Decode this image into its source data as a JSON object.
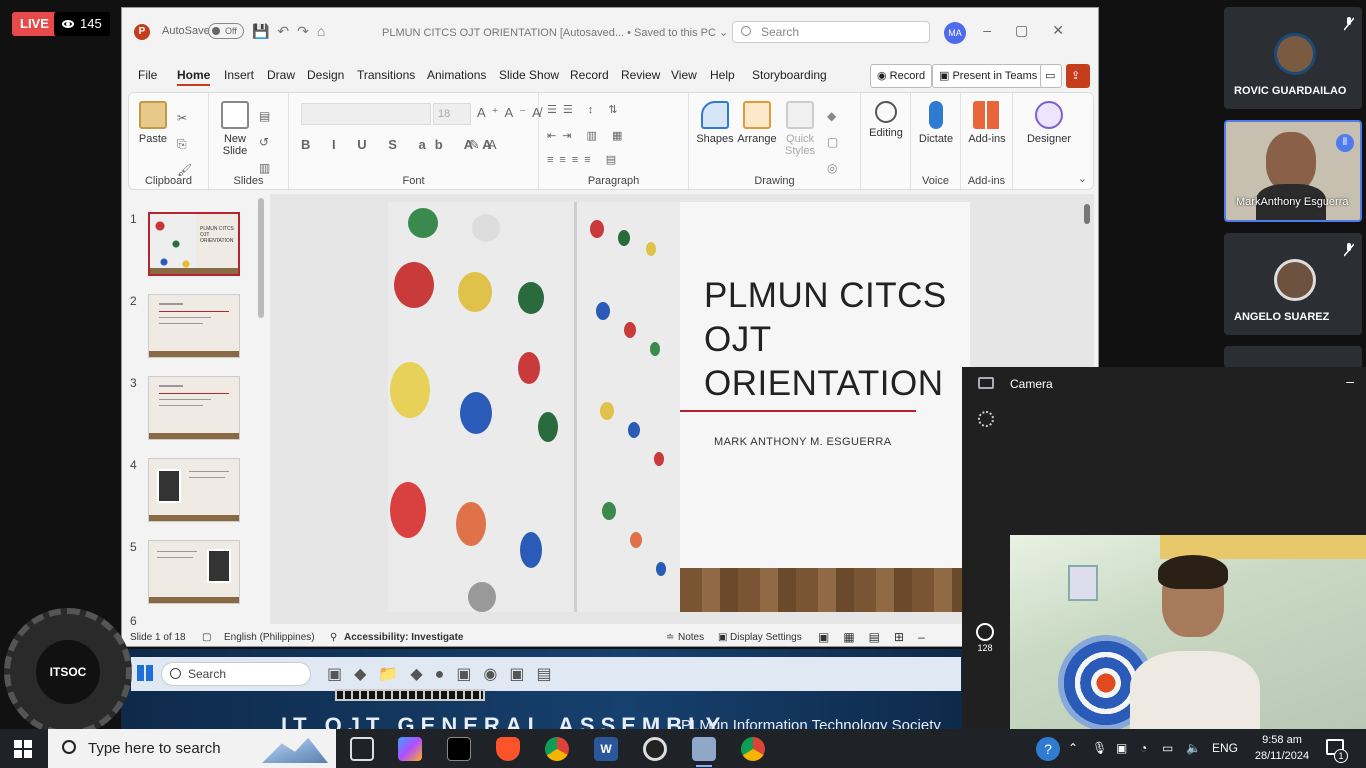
{
  "stream": {
    "live_label": "LIVE",
    "viewer_count": "145"
  },
  "powerpoint": {
    "autosave_label": "AutoSave",
    "autosave_state": "Off",
    "document_title": "PLMUN CITCS OJT ORIENTATION [Autosaved... • Saved to this PC ⌄",
    "search_placeholder": "Search",
    "account_initials": "MA",
    "menu_tabs": [
      "File",
      "Home",
      "Insert",
      "Draw",
      "Design",
      "Transitions",
      "Animations",
      "Slide Show",
      "Record",
      "Review",
      "View",
      "Help",
      "Storyboarding"
    ],
    "active_tab": "Home",
    "record_button": "Record",
    "present_button": "Present in Teams",
    "ribbon": {
      "clipboard_group": "Clipboard",
      "paste_label": "Paste",
      "slides_group": "Slides",
      "new_slide_label": "New Slide",
      "font_group": "Font",
      "font_size": "18",
      "font_format_buttons": "B I U S ab AA",
      "paragraph_group": "Paragraph",
      "drawing_group": "Drawing",
      "shapes_label": "Shapes",
      "arrange_label": "Arrange",
      "quick_styles_label": "Quick Styles",
      "editing_label": "Editing",
      "dictate_label": "Dictate",
      "voice_group": "Voice",
      "addins_label": "Add-ins",
      "addins_group": "Add-ins",
      "designer_label": "Designer"
    },
    "thumbnails": [
      {
        "number": "1",
        "title": "PLMUN CITCS OJT ORIENTATION"
      },
      {
        "number": "2",
        "title": ""
      },
      {
        "number": "3",
        "title": ""
      },
      {
        "number": "4",
        "title": ""
      },
      {
        "number": "5",
        "title": ""
      },
      {
        "number": "6",
        "title": ""
      }
    ],
    "slide": {
      "title": "PLMUN CITCS\nOJT\nORIENTATION",
      "subtitle": "MARK ANTHONY M. ESGUERRA"
    },
    "status": {
      "slide_info": "Slide 1 of 18",
      "language": "English (Philippines)",
      "accessibility": "Accessibility: Investigate",
      "notes": "Notes",
      "display_settings": "Display Settings"
    }
  },
  "participants": [
    {
      "name": "ROVIC GUARDAILAO",
      "muted": true
    },
    {
      "name": "MarkAnthony Esguerra",
      "muted": false
    },
    {
      "name": "ANGELO SUAREZ",
      "muted": true
    }
  ],
  "camera": {
    "window_title": "Camera",
    "counter": "128"
  },
  "overlay": {
    "logo_text": "ITSOC",
    "inner_search": "Search",
    "banner_title": "IT OJT GENERAL ASSEMBLY",
    "banner_sub": "PLMun Information Technology Society"
  },
  "taskbar": {
    "search_text": "Type here to search",
    "language": "ENG",
    "time": "9:58 am",
    "date": "28/11/2024",
    "notifications": "1"
  },
  "colors": {
    "accent_red": "#c43e1c",
    "live_red": "#e8494a",
    "slide_rule": "#b3262d"
  }
}
